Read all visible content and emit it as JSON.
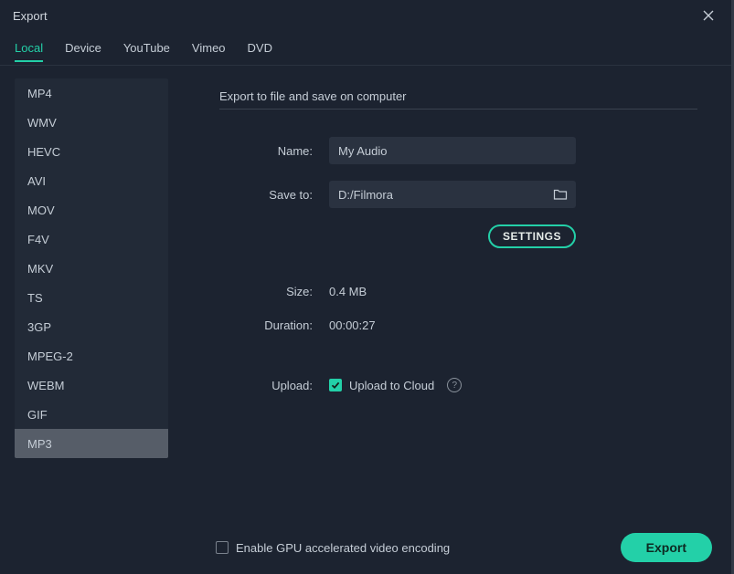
{
  "window": {
    "title": "Export"
  },
  "tabs": [
    {
      "label": "Local",
      "active": true
    },
    {
      "label": "Device"
    },
    {
      "label": "YouTube"
    },
    {
      "label": "Vimeo"
    },
    {
      "label": "DVD"
    }
  ],
  "formats": [
    {
      "label": "MP4"
    },
    {
      "label": "WMV"
    },
    {
      "label": "HEVC"
    },
    {
      "label": "AVI"
    },
    {
      "label": "MOV"
    },
    {
      "label": "F4V"
    },
    {
      "label": "MKV"
    },
    {
      "label": "TS"
    },
    {
      "label": "3GP"
    },
    {
      "label": "MPEG-2"
    },
    {
      "label": "WEBM"
    },
    {
      "label": "GIF"
    },
    {
      "label": "MP3",
      "selected": true
    }
  ],
  "main": {
    "section_title": "Export to file and save on computer",
    "name_label": "Name:",
    "name_value": "My Audio",
    "saveto_label": "Save to:",
    "saveto_value": "D:/Filmora",
    "settings_label": "SETTINGS",
    "size_label": "Size:",
    "size_value": "0.4 MB",
    "duration_label": "Duration:",
    "duration_value": "00:00:27",
    "upload_label": "Upload:",
    "upload_option": "Upload to Cloud",
    "upload_checked": true
  },
  "footer": {
    "gpu_label": "Enable GPU accelerated video encoding",
    "gpu_checked": false,
    "export_label": "Export"
  }
}
